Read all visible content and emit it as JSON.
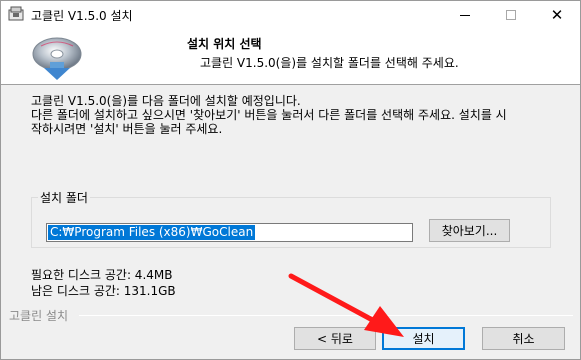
{
  "window": {
    "title": "고클린 V1.5.0 설치",
    "controls": {
      "minimize": "minimize",
      "maximize": "maximize",
      "close": "✕"
    }
  },
  "header": {
    "title": "설치 위치 선택",
    "subtitle": "고클린 V1.5.0(을)를 설치할 폴더를 선택해 주세요."
  },
  "intro": {
    "lines": [
      "고클린 V1.5.0(을)를 다음 폴더에 설치할 예정입니다.",
      "다른 폴더에 설치하고 싶으시면 '찾아보기' 버튼을 눌러서 다른 폴더를 선택해 주세요. 설치를 시",
      "작하시려면 '설치' 버튼을 눌러 주세요."
    ]
  },
  "folder": {
    "group_label": "설치 폴더",
    "path_value": "C:₩Program Files (x86)₩GoClean",
    "browse_label": "찾아보기..."
  },
  "space": {
    "required": "필요한 디스크 공간: 4.4MB",
    "available": "남은 디스크 공간: 131.1GB"
  },
  "footer": {
    "brand": "고클린 설치",
    "back_label": "< 뒤로",
    "install_label": "설치",
    "cancel_label": "취소"
  },
  "colors": {
    "accent": "#0078d7",
    "annotation_arrow": "#ff1a1a"
  },
  "icons": {
    "app": "installer-box-icon",
    "header_logo": "disc-download-icon"
  }
}
